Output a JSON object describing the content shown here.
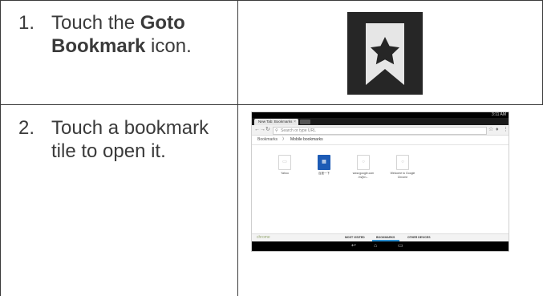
{
  "steps": [
    {
      "number": "1.",
      "text_pre": "Touch the ",
      "text_bold": "Goto Bookmark",
      "text_post": " icon."
    },
    {
      "number": "2.",
      "text": "Touch a bookmark tile to open it."
    }
  ],
  "screenshot": {
    "status_time": "3:11 AM",
    "tab_title": "New Tab: Bookmarks",
    "omnibox_placeholder": "Search or type URL",
    "breadcrumb": [
      "Bookmarks",
      "Mobile bookmarks"
    ],
    "tiles": [
      {
        "label": "Yahoo",
        "style": "plain"
      },
      {
        "label": "百度一下",
        "style": "blue"
      },
      {
        "label": "www.google.com /m/[en...",
        "style": "plain"
      },
      {
        "label": "Welcome to Google Chrome",
        "style": "plain"
      }
    ],
    "bottom_logo": "chrome",
    "bottom_tabs": [
      "MOST VISITED",
      "BOOKMARKS",
      "OTHER DEVICES"
    ],
    "colors": {
      "accent": "#2a8fd0",
      "border": "#3a3a3a"
    },
    "icons": [
      "goto-bookmark-icon",
      "back-icon",
      "home-icon",
      "recent-apps-icon"
    ]
  }
}
